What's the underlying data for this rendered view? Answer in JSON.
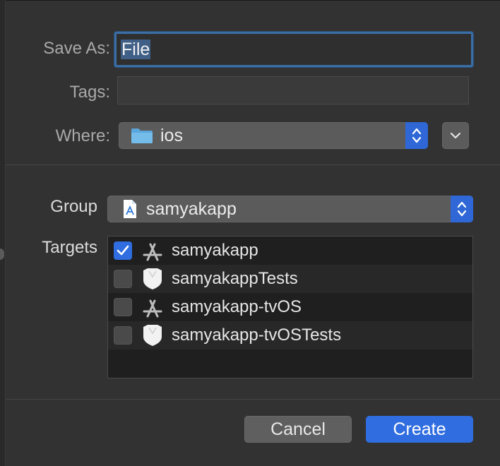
{
  "form": {
    "save_as_label": "Save As:",
    "save_as_value": "File",
    "tags_label": "Tags:",
    "tags_value": "",
    "where_label": "Where:",
    "where_value": "ios",
    "group_label": "Group",
    "group_value": "samyakapp",
    "targets_label": "Targets"
  },
  "targets": [
    {
      "label": "samyakapp",
      "checked": true,
      "icon": "app-store-icon"
    },
    {
      "label": "samyakappTests",
      "checked": false,
      "icon": "test-shield-icon"
    },
    {
      "label": "samyakapp-tvOS",
      "checked": false,
      "icon": "app-store-icon"
    },
    {
      "label": "samyakapp-tvOSTests",
      "checked": false,
      "icon": "test-shield-icon"
    }
  ],
  "buttons": {
    "cancel": "Cancel",
    "create": "Create"
  },
  "colors": {
    "accent": "#2f6de0",
    "sheet_bg": "#323232",
    "focus_ring": "#3b6ea5"
  }
}
